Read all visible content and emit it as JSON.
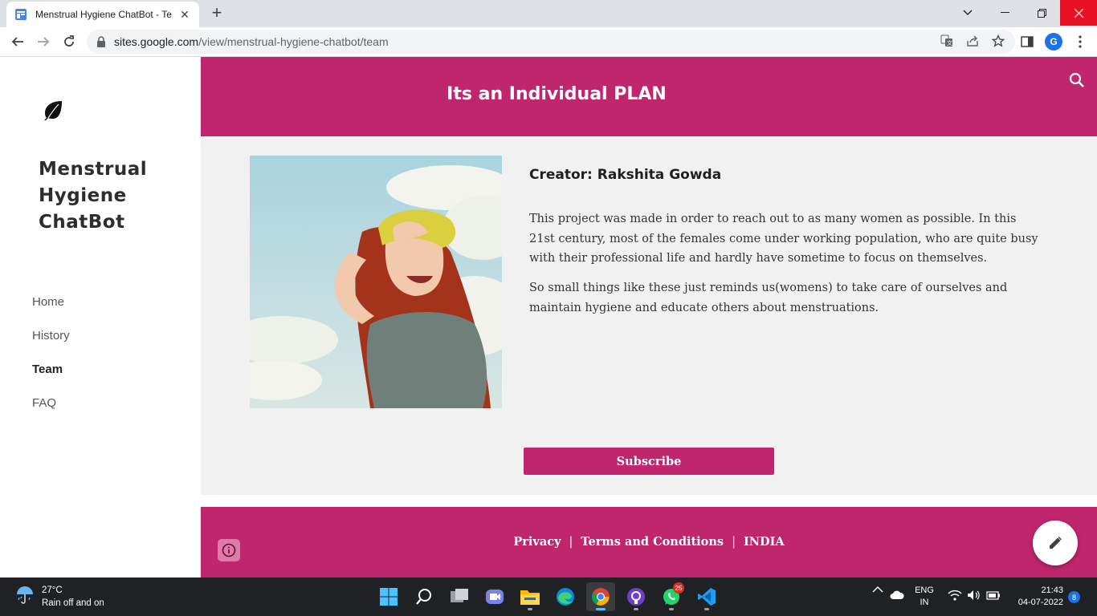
{
  "browser": {
    "tab_title": "Menstrual Hygiene ChatBot - Team",
    "url_host": "sites.google.com",
    "url_path": "/view/menstrual-hygiene-chatbot/team",
    "profile_initial": "G"
  },
  "site": {
    "title": "Menstrual Hygiene ChatBot",
    "nav": [
      {
        "label": "Home",
        "active": false
      },
      {
        "label": "History",
        "active": false
      },
      {
        "label": "Team",
        "active": true
      },
      {
        "label": "FAQ",
        "active": false
      }
    ],
    "banner_title": "Its an Individual PLAN",
    "creator": "Creator: Rakshita Gowda",
    "paragraph_1": "This project was made  in order to reach out to as many women as possible. In this 21st century, most of the females come under working population, who are quite busy with their professional life and hardly have sometime to focus on themselves.",
    "paragraph_2": "So small things like these just reminds us(womens) to take care of ourselves and maintain hygiene and educate others about menstruations.",
    "subscribe_label": "Subscribe",
    "footer": {
      "privacy": "Privacy",
      "separator": "|",
      "terms": "Terms and Conditions",
      "country": "INDIA"
    },
    "accent_color": "#c0266d"
  },
  "taskbar": {
    "temperature": "27°C",
    "weather": "Rain off and on",
    "whatsapp_badge": "25",
    "lang_1": "ENG",
    "lang_2": "IN",
    "time": "21:43",
    "date": "04-07-2022",
    "notifications": "8"
  },
  "icons": [
    "google-sites-icon",
    "close-icon",
    "plus-icon",
    "chevron-down-icon",
    "minimize-icon",
    "restore-icon",
    "back-icon",
    "forward-icon",
    "reload-icon",
    "lock-icon",
    "translate-icon",
    "share-icon",
    "star-icon",
    "side-panel-icon",
    "search-icon",
    "leaf-icon",
    "info-icon",
    "pencil-icon",
    "start-icon",
    "taskbar-search-icon",
    "task-view-icon",
    "teams-icon",
    "file-explorer-icon",
    "edge-icon",
    "chrome-icon",
    "github-icon",
    "whatsapp-icon",
    "vscode-icon",
    "wifi-icon",
    "volume-icon",
    "battery-icon",
    "cloud-icon",
    "chevron-up-icon",
    "weather-icon"
  ]
}
